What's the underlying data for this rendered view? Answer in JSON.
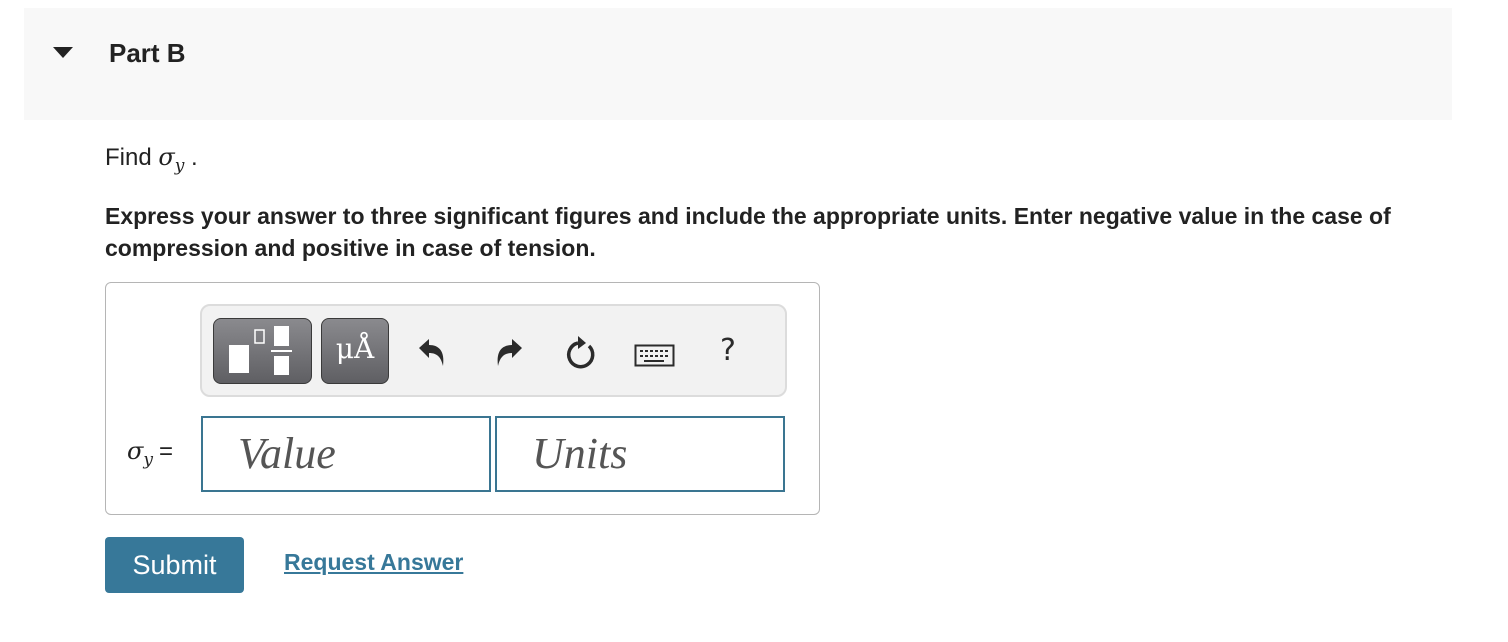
{
  "part": {
    "title": "Part B",
    "collapse_icon": "caret-down-icon"
  },
  "question": {
    "prefix": "Find ",
    "symbol": "σ",
    "subscript": "y",
    "suffix": " .",
    "instructions": "Express your answer to three significant figures and include the appropriate units. Enter negative value in the case of compression and positive in case of tension."
  },
  "toolbar": {
    "buttons": [
      {
        "name": "templates-button",
        "icon": "fraction-template-icon"
      },
      {
        "name": "units-button",
        "icon": "units-icon",
        "label": "μÅ"
      },
      {
        "name": "undo-button",
        "icon": "undo-icon"
      },
      {
        "name": "redo-button",
        "icon": "redo-icon"
      },
      {
        "name": "reset-button",
        "icon": "reset-icon"
      },
      {
        "name": "keyboard-button",
        "icon": "keyboard-icon"
      },
      {
        "name": "help-button",
        "icon": "help-icon",
        "label": "?"
      }
    ]
  },
  "answer": {
    "label_symbol": "σ",
    "label_subscript": "y",
    "label_equals": "=",
    "value": "",
    "value_placeholder": "Value",
    "units": "",
    "units_placeholder": "Units"
  },
  "actions": {
    "submit_label": "Submit",
    "request_answer_label": "Request Answer"
  },
  "colors": {
    "accent": "#377899",
    "field_border": "#3a7591",
    "header_bg": "#f8f8f8"
  }
}
